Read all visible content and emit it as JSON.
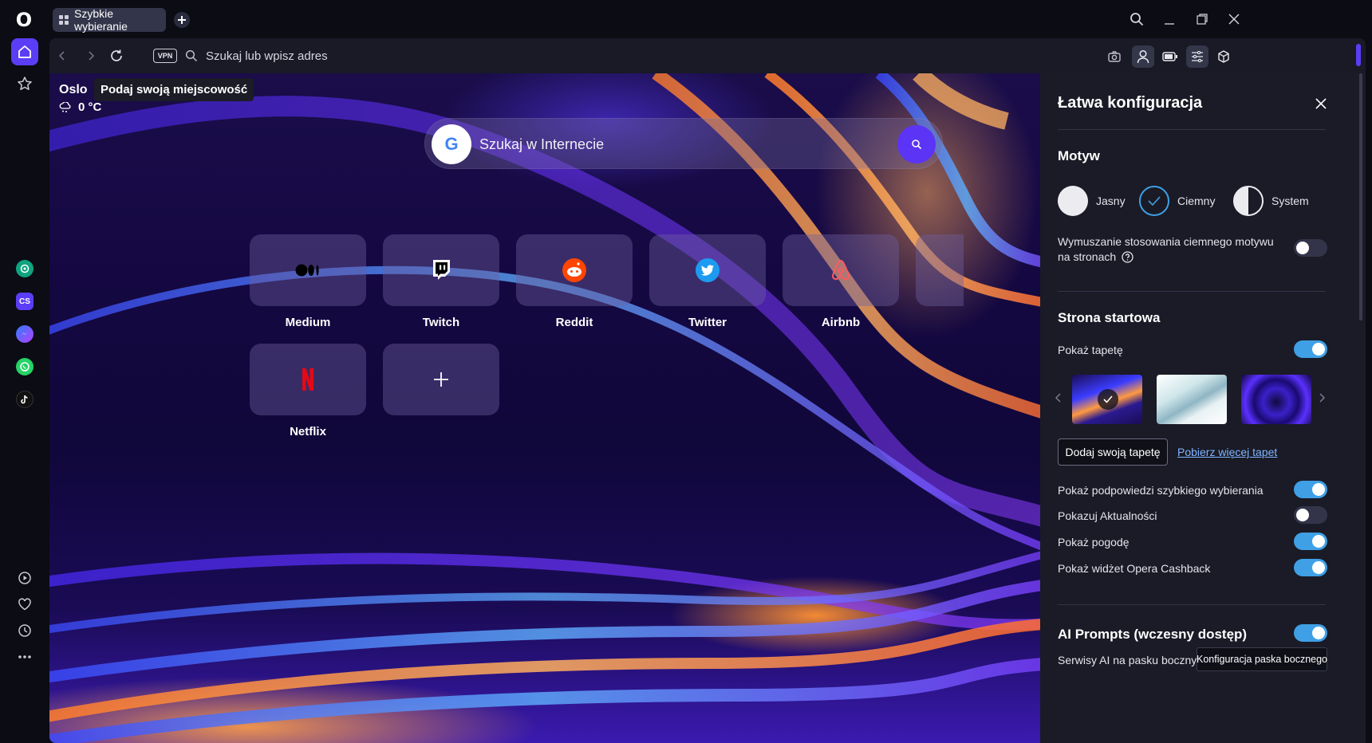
{
  "browser": {
    "logo_text": "O",
    "tab": {
      "label": "Szybkie wybieranie",
      "icon": "grid-icon"
    },
    "new_tab_icon": "plus-icon",
    "window_controls": [
      "search-icon",
      "minimize-icon",
      "restore-icon",
      "close-icon"
    ]
  },
  "sidebar": {
    "top_items": [
      "home-icon",
      "bookmarks-icon"
    ],
    "apps": [
      {
        "name": "chatgpt-icon",
        "color": "#10a37f"
      },
      {
        "name": "cs-icon",
        "label": "CS",
        "color": "#5b3df5"
      },
      {
        "name": "messenger-icon",
        "color": "#7b5cff"
      },
      {
        "name": "whatsapp-icon",
        "color": "#25d366"
      },
      {
        "name": "tiktok-icon",
        "color": "#111111"
      }
    ],
    "bottom_items": [
      "player-icon",
      "heart-icon",
      "history-icon",
      "more-icon"
    ]
  },
  "addressbar": {
    "vpn_label": "VPN",
    "placeholder": "Szukaj lub wpisz adres",
    "tools": [
      "camera-icon",
      "profile-icon",
      "battery-icon",
      "easy-setup-icon",
      "extensions-icon"
    ]
  },
  "speeddial": {
    "weather": {
      "city": "Oslo",
      "tooltip": "Podaj swoją miejscowość",
      "temp": "0 °C"
    },
    "search": {
      "placeholder": "Szukaj w Internecie",
      "logo": "G"
    },
    "tiles": [
      {
        "label": "Medium",
        "icon": "medium-icon"
      },
      {
        "label": "Twitch",
        "icon": "twitch-icon"
      },
      {
        "label": "Reddit",
        "icon": "reddit-icon"
      },
      {
        "label": "Twitter",
        "icon": "twitter-icon"
      },
      {
        "label": "Airbnb",
        "icon": "airbnb-icon"
      },
      {
        "label": "Netflix",
        "icon": "netflix-icon"
      },
      {
        "label": "",
        "icon": "plus-icon"
      }
    ]
  },
  "panel": {
    "title": "Łatwa konfiguracja",
    "theme": {
      "title": "Motyw",
      "options": [
        "Jasny",
        "Ciemny",
        "System"
      ],
      "selected": "Ciemny",
      "force_dark_label": "Wymuszanie stosowania ciemnego motywu na stronach",
      "force_dark_on": false
    },
    "start": {
      "title": "Strona startowa",
      "show_wallpaper_label": "Pokaż tapetę",
      "show_wallpaper_on": true,
      "add_wallpaper_button": "Dodaj swoją tapetę",
      "more_wallpapers_link": "Pobierz więcej tapet",
      "toggles": [
        {
          "label": "Pokaż podpowiedzi szybkiego wybierania",
          "on": true
        },
        {
          "label": "Pokazuj Aktualności",
          "on": false
        },
        {
          "label": "Pokaż pogodę",
          "on": true
        },
        {
          "label": "Pokaż widżet Opera Cashback",
          "on": true
        }
      ]
    },
    "ai": {
      "title": "AI Prompts (wczesny dostęp)",
      "on": true,
      "services_label": "Serwisy AI na pasku bocznym",
      "tooltip": "Konfiguracja paska bocznego"
    }
  },
  "colors": {
    "accent": "#5b3df5",
    "toggle_on": "#3fa0e6",
    "panel_bg": "#1a1b26"
  }
}
